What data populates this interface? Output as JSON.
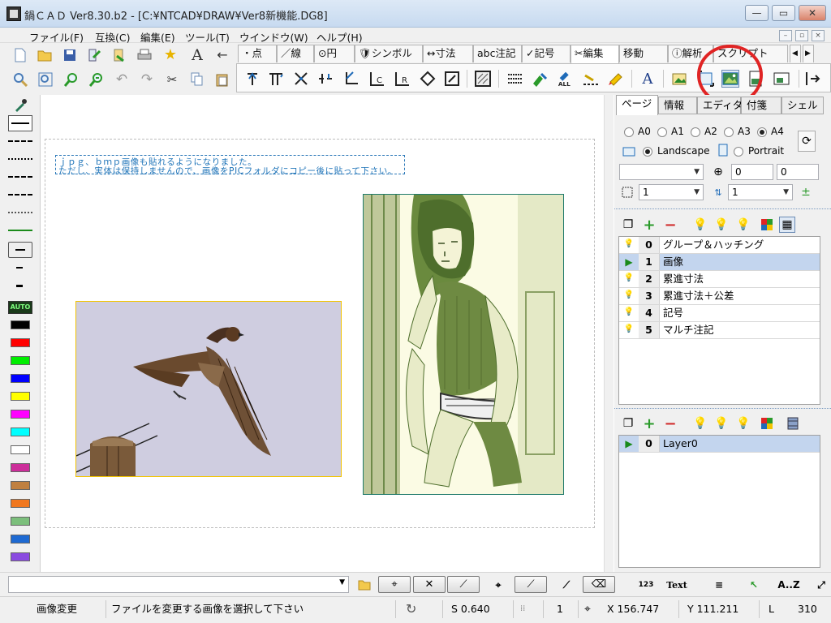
{
  "window": {
    "title": "鍋ＣＡＤ Ver8.30.b2 - [C:¥NTCAD¥DRAW¥Ver8新機能.DG8]",
    "min_glyph": "—",
    "max_glyph": "▭",
    "close_glyph": "✕"
  },
  "menu": [
    "ファイル(F)",
    "互換(C)",
    "編集(E)",
    "ツール(T)",
    "ウインドウ(W)",
    "ヘルプ(H)"
  ],
  "mode_tabs": [
    "・点",
    "／線",
    "⊙円",
    "🛡シンボル",
    "↔寸法",
    "abc注記",
    "✓記号",
    "✂編集",
    "移動",
    "ⓘ解析",
    "スクリプト"
  ],
  "canvas": {
    "note_lines": [
      "ｊｐｇ、ｂｍｐ画像も貼れるようになりました。",
      "ただし、実体は保持しませんので、画像をPICフォルダにコピー後に貼って下さい。"
    ]
  },
  "left_palette": {
    "auto_label": "AUTO",
    "colors": [
      "#000000",
      "#ff0000",
      "#00ee00",
      "#0000ff",
      "#ffff00",
      "#ff00ff",
      "#00ffff",
      "#ffffff",
      "#cc2e9a",
      "#c08040",
      "#f07820",
      "#7cbf7c",
      "#1e6ad2",
      "#8a4be0"
    ]
  },
  "right_panel": {
    "tabs": [
      "ページ",
      "情報",
      "エディタ",
      "付箋",
      "シェル"
    ],
    "sizes": [
      "A0",
      "A1",
      "A2",
      "A3",
      "A4"
    ],
    "selected_size": "A4",
    "landscape_label": "Landscape",
    "portrait_label": "Portrait",
    "offset_x": "0",
    "offset_y": "0",
    "scale_a": "1",
    "scale_b": "1",
    "layer_groups": [
      {
        "num": "0",
        "name": "グループ＆ハッチング"
      },
      {
        "num": "1",
        "name": "画像"
      },
      {
        "num": "2",
        "name": "累進寸法"
      },
      {
        "num": "3",
        "name": "累進寸法＋公差"
      },
      {
        "num": "4",
        "name": "記号"
      },
      {
        "num": "5",
        "name": "マルチ注記"
      }
    ],
    "layers": [
      {
        "num": "0",
        "name": "Layer0"
      }
    ]
  },
  "bottom_icons": {
    "num_label": "123",
    "text_label": "Text",
    "az_label": "A..Z"
  },
  "status": {
    "mode": "画像変更",
    "message": "ファイルを変更する画像を選択して下さい",
    "scale": "S 0.640",
    "layer": "1",
    "x": "X 156.747",
    "y": "Y 111.211",
    "l_label": "L",
    "l_value": "310"
  }
}
